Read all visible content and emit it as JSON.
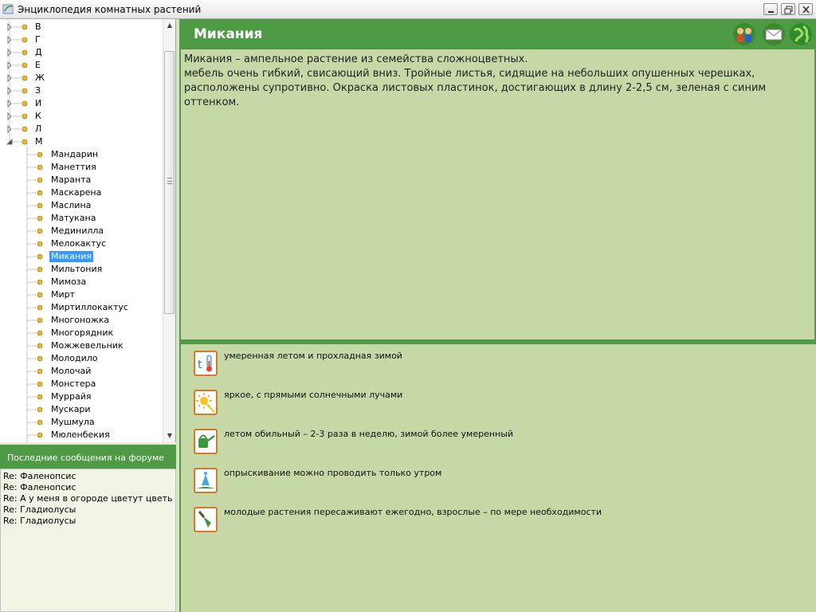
{
  "window": {
    "title": "Энциклопедия комнатных растений"
  },
  "tree": {
    "letters": [
      "В",
      "Г",
      "Д",
      "Е",
      "Ж",
      "З",
      "И",
      "К",
      "Л",
      "М"
    ],
    "expanded_letter": "М",
    "plants": [
      "Мандарин",
      "Манеттия",
      "Маранта",
      "Маскарена",
      "Маслина",
      "Матукана",
      "Мединилла",
      "Мелокактус",
      "Микания",
      "Мильтония",
      "Мимоза",
      "Мирт",
      "Миртиллокактус",
      "Многоножка",
      "Многорядник",
      "Можжевельник",
      "Молодило",
      "Молочай",
      "Монстера",
      "Муррайя",
      "Мускари",
      "Мушмула",
      "Мюленбекия"
    ],
    "selected_plant": "Микания"
  },
  "forum": {
    "header": "Последние сообщения на форуме",
    "items": [
      "Re: Фаленопсис",
      "Re: Фаленопсис",
      "Re: А у меня в огороде цветут цветы...",
      "Re: Гладиолусы",
      "Re: Гладиолусы"
    ]
  },
  "plant": {
    "title": "Микания",
    "description_lines": [
      "Микания – ампельное растение из семейства сложноцветных.",
      "мебель очень гибкий, свисающий вниз. Тройные листья, сидящие на небольших опушенных черешках,",
      "расположены супротивно. Окраска листовых пластинок, достигающих в длину 2-2,5 см, зеленая с синим",
      "оттенком."
    ]
  },
  "care": [
    {
      "icon": "thermometer-icon",
      "text": "умеренная летом и прохладная зимой"
    },
    {
      "icon": "sun-icon",
      "text": "яркое, с прямыми солнечными лучами"
    },
    {
      "icon": "watering-can-icon",
      "text": "летом обильный – 2-3 раза в неделю, зимой более умеренный"
    },
    {
      "icon": "spray-icon",
      "text": "опрыскивание можно проводить только утром"
    },
    {
      "icon": "trowel-icon",
      "text": "молодые растения пересаживают ежегодно, взрослые – по мере необходимости"
    }
  ],
  "colors": {
    "accent": "#4f9b45",
    "panel": "#c5d8a6",
    "selection": "#3399ff",
    "care_border": "#d9772b"
  }
}
